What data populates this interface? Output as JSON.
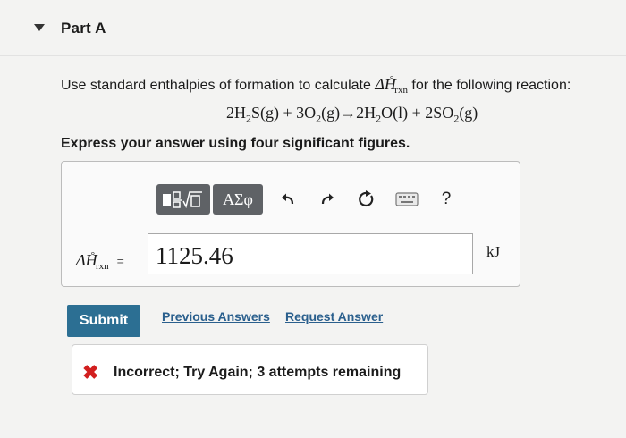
{
  "part": {
    "title": "Part A"
  },
  "question": {
    "prefix": "Use standard enthalpies of formation to calculate ",
    "delta": "ΔH",
    "superscript": "°",
    "subscript": "rxn",
    "suffix": " for the following reaction:"
  },
  "reaction": {
    "lhs1_coef": "2H",
    "lhs1_sub": "2",
    "lhs1_rest": "S(g) + 3O",
    "lhs2_sub": "2",
    "arrow_part": "(g)→2H",
    "rhs1_sub": "2",
    "rhs1_rest": "O(l) + 2SO",
    "rhs2_sub": "2",
    "rhs2_rest": "(g)"
  },
  "instruction": "Express your answer using four significant figures.",
  "toolbar": {
    "templates_icon": "templates-icon",
    "symbols_label": "ΑΣφ",
    "undo_icon": "undo-icon",
    "redo_icon": "redo-icon",
    "reset_icon": "reset-icon",
    "keyboard_icon": "keyboard-icon",
    "help_label": "?"
  },
  "answer": {
    "label_delta": "ΔH",
    "label_sup": "°",
    "label_sub": "rxn",
    "equals": "=",
    "value": "1125.46",
    "unit": "kJ"
  },
  "actions": {
    "submit": "Submit",
    "previous_answers": "Previous Answers",
    "request_answer": "Request Answer"
  },
  "feedback": {
    "icon": "x-icon",
    "text": "Incorrect; Try Again; 3 attempts remaining",
    "color": "#d21f1f"
  }
}
